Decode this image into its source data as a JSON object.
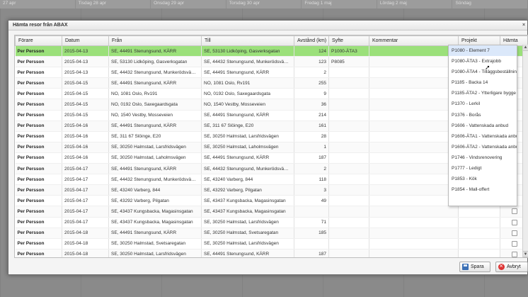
{
  "calendar": {
    "days": [
      "27 apr",
      "Tisdag 28 apr",
      "Onsdag 29 apr",
      "Torsdag 30 apr",
      "Fredag 1 maj",
      "Lördag 2 maj",
      "Söndag"
    ]
  },
  "dialog": {
    "title": "Hämta resor från ABAX",
    "close_icon": "close-icon",
    "columns": [
      "Förare",
      "Datum",
      "Från",
      "Till",
      "Avstånd (km)",
      "Syfte",
      "Kommentar",
      "Projekt",
      "Hämta"
    ],
    "rows": [
      {
        "driver": "Per Persson",
        "date": "2015-04-13",
        "from": "SE, 44491 Stenungsund, KÄRR",
        "to": "SE, 53130 Lidköping, Gasverksgatan",
        "distance": "124",
        "purpose": "P1000-ÄTA3",
        "comment": "",
        "checked": true
      },
      {
        "driver": "Per Persson",
        "date": "2015-04-13",
        "from": "SE, 53130 Lidköping, Gasverksgatan",
        "to": "SE, 44432 Stenungsund, Munkerödsvä…",
        "distance": "123",
        "purpose": "P8085",
        "comment": "",
        "checked": false
      },
      {
        "driver": "Per Persson",
        "date": "2015-04-13",
        "from": "SE, 44432 Stenungsund, Munkerödsvä…",
        "to": "SE, 44491 Stenungsund, KÄRR",
        "distance": "2",
        "purpose": "",
        "comment": "",
        "checked": false
      },
      {
        "driver": "Per Persson",
        "date": "2015-04-15",
        "from": "SE, 44491 Stenungsund, KÄRR",
        "to": "NO, 1081 Oslo, Rv191",
        "distance": "255",
        "purpose": "",
        "comment": "",
        "checked": false
      },
      {
        "driver": "Per Persson",
        "date": "2015-04-15",
        "from": "NO, 1081 Oslo, Rv191",
        "to": "NO, 0192 Oslo, Saxegaardsgata",
        "distance": "9",
        "purpose": "",
        "comment": "",
        "checked": false
      },
      {
        "driver": "Per Persson",
        "date": "2015-04-15",
        "from": "NO, 0192 Oslo, Saxegaardsgata",
        "to": "NO, 1540 Vestby, Mosseveien",
        "distance": "36",
        "purpose": "",
        "comment": "",
        "checked": false
      },
      {
        "driver": "Per Persson",
        "date": "2015-04-15",
        "from": "NO, 1540 Vestby, Mosseveien",
        "to": "SE, 44491 Stenungsund, KÄRR",
        "distance": "214",
        "purpose": "",
        "comment": "",
        "checked": false
      },
      {
        "driver": "Per Persson",
        "date": "2015-04-16",
        "from": "SE, 44491 Stenungsund, KÄRR",
        "to": "SE, 311 67 Slöinge, E20",
        "distance": "161",
        "purpose": "",
        "comment": "",
        "checked": false
      },
      {
        "driver": "Per Persson",
        "date": "2015-04-16",
        "from": "SE, 311 67 Slöinge, E20",
        "to": "SE, 30250 Halmstad, Larsfridsvägen",
        "distance": "28",
        "purpose": "",
        "comment": "",
        "checked": false
      },
      {
        "driver": "Per Persson",
        "date": "2015-04-16",
        "from": "SE, 30250 Halmstad, Larsfridsvägen",
        "to": "SE, 30250 Halmstad, Laholmsvägen",
        "distance": "1",
        "purpose": "",
        "comment": "",
        "checked": false
      },
      {
        "driver": "Per Persson",
        "date": "2015-04-16",
        "from": "SE, 30250 Halmstad, Laholmsvägen",
        "to": "SE, 44491 Stenungsund, KÄRR",
        "distance": "187",
        "purpose": "",
        "comment": "",
        "checked": false
      },
      {
        "driver": "Per Persson",
        "date": "2015-04-17",
        "from": "SE, 44491 Stenungsund, KÄRR",
        "to": "SE, 44432 Stenungsund, Munkerödsvä…",
        "distance": "2",
        "purpose": "",
        "comment": "",
        "checked": false
      },
      {
        "driver": "Per Persson",
        "date": "2015-04-17",
        "from": "SE, 44432 Stenungsund, Munkerödsvä…",
        "to": "SE, 43240 Varberg, 844",
        "distance": "118",
        "purpose": "",
        "comment": "",
        "checked": false
      },
      {
        "driver": "Per Persson",
        "date": "2015-04-17",
        "from": "SE, 43240 Varberg, 844",
        "to": "SE, 43292 Varberg, Pilgatan",
        "distance": "3",
        "purpose": "",
        "comment": "",
        "checked": false
      },
      {
        "driver": "Per Persson",
        "date": "2015-04-17",
        "from": "SE, 43292 Varberg, Pilgatan",
        "to": "SE, 43437 Kungsbacka, Magasinsgatan",
        "distance": "49",
        "purpose": "",
        "comment": "",
        "checked": false
      },
      {
        "driver": "Per Persson",
        "date": "2015-04-17",
        "from": "SE, 43437 Kungsbacka, Magasinsgatan",
        "to": "SE, 43437 Kungsbacka, Magasinsgatan",
        "distance": "",
        "purpose": "",
        "comment": "",
        "checked": false
      },
      {
        "driver": "Per Persson",
        "date": "2015-04-17",
        "from": "SE, 43437 Kungsbacka, Magasinsgatan",
        "to": "SE, 30250 Halmstad, Larsfridsvägen",
        "distance": "71",
        "purpose": "",
        "comment": "",
        "checked": false
      },
      {
        "driver": "Per Persson",
        "date": "2015-04-18",
        "from": "SE, 44491 Stenungsund, KÄRR",
        "to": "SE, 30250 Halmstad, Svetsaregatan",
        "distance": "185",
        "purpose": "",
        "comment": "",
        "checked": false
      },
      {
        "driver": "Per Persson",
        "date": "2015-04-18",
        "from": "SE, 30250 Halmstad, Svetsaregatan",
        "to": "SE, 30250 Halmstad, Larsfridsvägen",
        "distance": "",
        "purpose": "",
        "comment": "",
        "checked": false
      },
      {
        "driver": "Per Persson",
        "date": "2015-04-18",
        "from": "SE, 30250 Halmstad, Larsfridsvägen",
        "to": "SE, 44491 Stenungsund, KÄRR",
        "distance": "187",
        "purpose": "",
        "comment": "",
        "checked": false
      }
    ],
    "project_options": [
      "P1080 - Element 7",
      "P1080-ÄTA3 - Extrajobb",
      "P1080-ÄTA4 - Tilläggsbeställning",
      "P1185 - Backa 14",
      "P1185-ÄTA2 - Ytterligare bygge",
      "P1370 - Lerkil",
      "P1376 - Borås",
      "P1606 - Vattenskada anbud",
      "P1606-ÄTA1 - Vattenskada anbud",
      "P1606-ÄTA2 - Vattenskada anbud",
      "P1746 - Vindsrenovering",
      "P1777 - Ledigt",
      "P1853 - Kök",
      "P1854 - Mall-offert"
    ],
    "hovered_option_index": 0,
    "save_label": "Spara",
    "cancel_label": "Avbryt"
  }
}
